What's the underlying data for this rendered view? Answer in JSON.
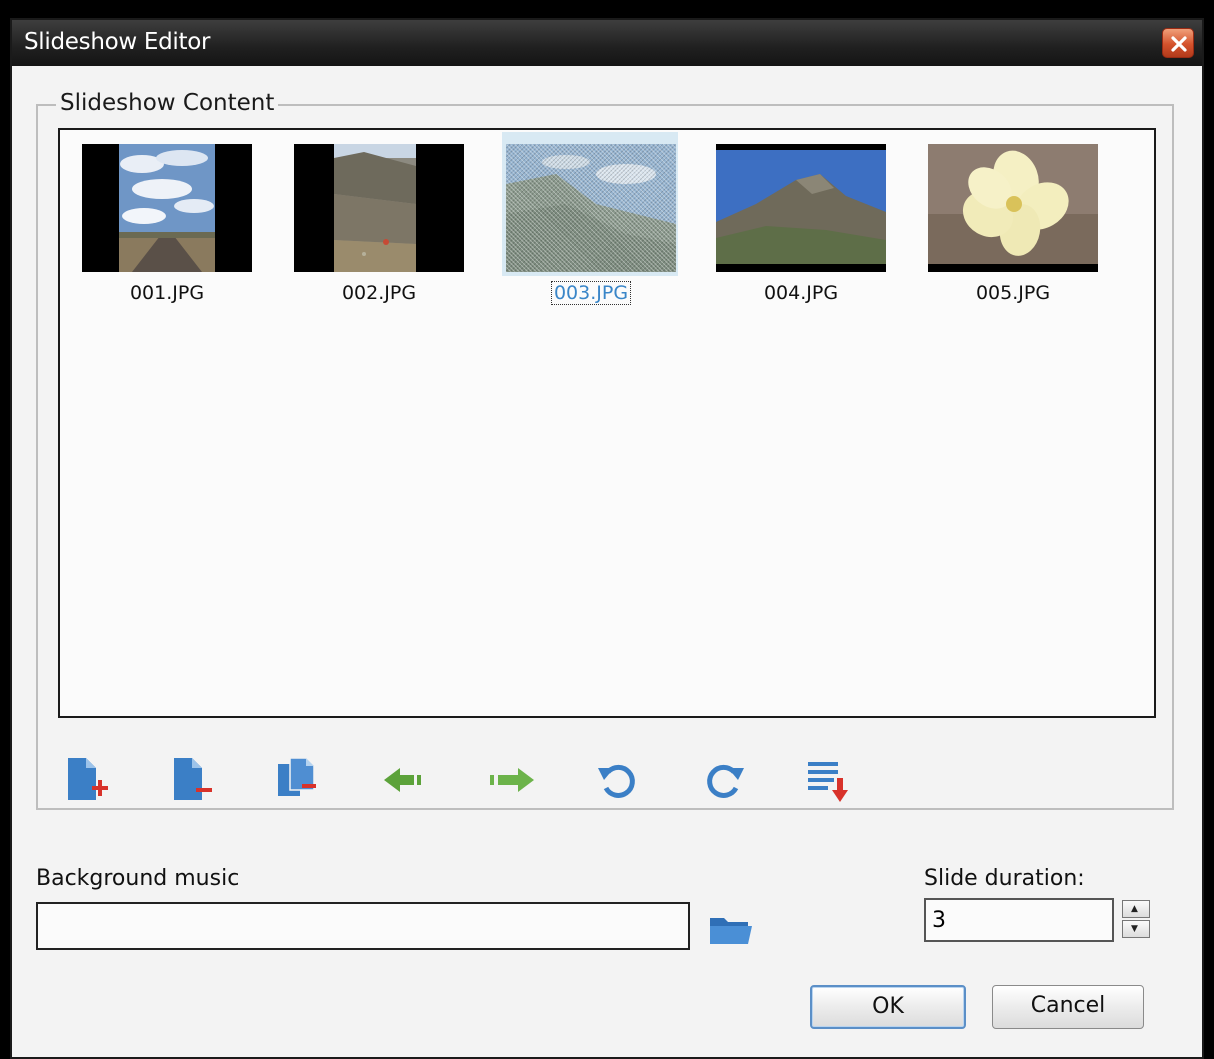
{
  "window": {
    "title": "Slideshow Editor",
    "close_icon": "close-icon"
  },
  "content": {
    "legend": "Slideshow Content",
    "slides": [
      {
        "name": "001.JPG",
        "selected": false
      },
      {
        "name": "002.JPG",
        "selected": false
      },
      {
        "name": "003.JPG",
        "selected": true
      },
      {
        "name": "004.JPG",
        "selected": false
      },
      {
        "name": "005.JPG",
        "selected": false
      }
    ]
  },
  "toolbar": {
    "icons": [
      "add-slide-icon",
      "remove-slide-icon",
      "remove-all-slides-icon",
      "move-left-icon",
      "move-right-icon",
      "rotate-left-icon",
      "rotate-right-icon",
      "sort-icon"
    ]
  },
  "music": {
    "label": "Background music",
    "value": "",
    "browse_icon": "folder-icon"
  },
  "duration": {
    "label": "Slide duration:",
    "value": "3"
  },
  "buttons": {
    "ok": "OK",
    "cancel": "Cancel"
  },
  "colors": {
    "titlebar": "#202020",
    "selection": "#3a86c8",
    "icon_blue": "#3b7fc6",
    "icon_green": "#5ca23a",
    "close_red": "#d4522c"
  }
}
